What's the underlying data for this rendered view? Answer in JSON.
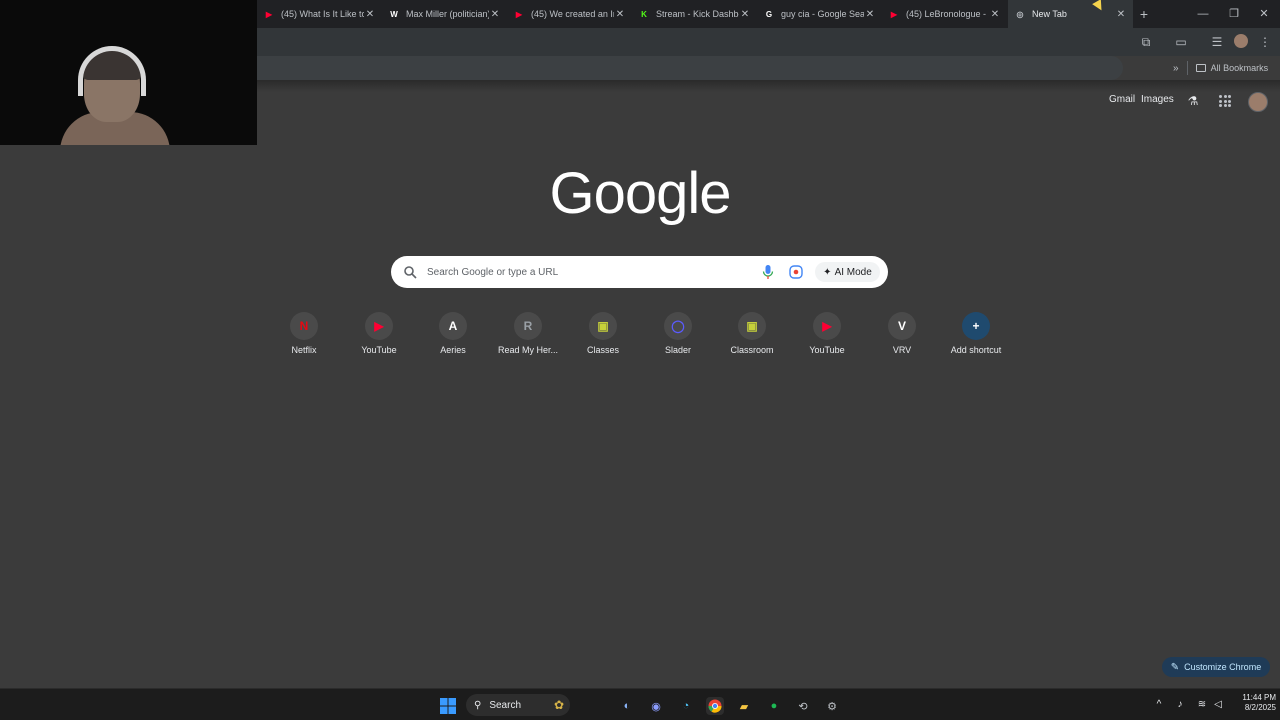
{
  "tabs": [
    {
      "title": "(45) What Is It Like to",
      "favicon": "youtube-icon",
      "color": "#ff0033",
      "glyph": "▶",
      "active": false
    },
    {
      "title": "Max Miller (politician)",
      "favicon": "wikipedia-icon",
      "color": "#ffffff",
      "glyph": "W",
      "active": false
    },
    {
      "title": "(45) We created an In",
      "favicon": "youtube-icon",
      "color": "#ff0033",
      "glyph": "▶",
      "active": false
    },
    {
      "title": "Stream - Kick Dashbo",
      "favicon": "kick-icon",
      "color": "#53fc18",
      "glyph": "K",
      "active": false
    },
    {
      "title": "guy cia - Google Sear",
      "favicon": "google-icon",
      "color": "#ffffff",
      "glyph": "G",
      "active": false
    },
    {
      "title": "(45) LeBronologue - S",
      "favicon": "youtube-icon",
      "color": "#ff0033",
      "glyph": "▶",
      "active": false
    },
    {
      "title": "New Tab",
      "favicon": "chrome-icon",
      "color": "#bdc1c6",
      "glyph": "◎",
      "active": true
    }
  ],
  "bookmarks": {
    "all_label": "All Bookmarks"
  },
  "ntp": {
    "gmail_label": "Gmail",
    "images_label": "Images",
    "logo_text": "Google",
    "search_placeholder": "Search Google or type a URL",
    "ai_mode_label": "AI Mode",
    "customize_label": "Customize Chrome"
  },
  "shortcuts": [
    {
      "label": "Netflix",
      "glyph": "N",
      "color": "#e50914",
      "icon": "netflix-icon"
    },
    {
      "label": "YouTube",
      "glyph": "▶",
      "color": "#ff0033",
      "icon": "youtube-icon"
    },
    {
      "label": "Aeries",
      "glyph": "A",
      "color": "#ffffff",
      "icon": "aeries-icon"
    },
    {
      "label": "Read My Her...",
      "glyph": "R",
      "color": "#9aa0a6",
      "icon": "read-my-hero-icon"
    },
    {
      "label": "Classes",
      "glyph": "▣",
      "color": "#c6d13a",
      "icon": "google-classroom-icon"
    },
    {
      "label": "Slader",
      "glyph": "◯",
      "color": "#5b5bff",
      "icon": "slader-icon"
    },
    {
      "label": "Classroom",
      "glyph": "▣",
      "color": "#c6d13a",
      "icon": "google-classroom-icon"
    },
    {
      "label": "YouTube",
      "glyph": "▶",
      "color": "#ff0033",
      "icon": "youtube-icon"
    },
    {
      "label": "VRV",
      "glyph": "V",
      "color": "#ffffff",
      "icon": "vrv-icon"
    },
    {
      "label": "Add shortcut",
      "glyph": "+",
      "color": "#ffffff",
      "icon": "add-icon"
    }
  ],
  "taskbar": {
    "search_label": "Search",
    "time": "11:44 PM",
    "date": "8/2/2025"
  },
  "colors": {
    "background": "#3b3b3b",
    "tabstrip": "#202124",
    "toolbar": "#323639",
    "customize_bg": "#1f3b57",
    "customize_text": "#c2e7ff"
  }
}
